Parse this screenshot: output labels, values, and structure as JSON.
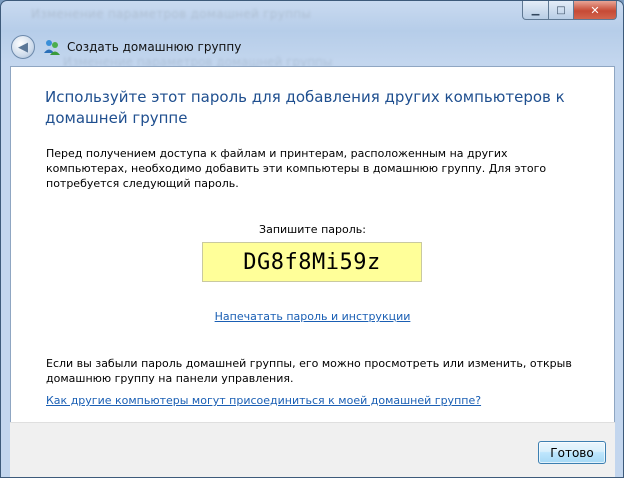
{
  "window": {
    "background_title": "Изменение параметров домашней группы",
    "background_crumb": "Изменение параметров домашней группы"
  },
  "nav": {
    "breadcrumb": "Создать домашнюю группу"
  },
  "main": {
    "heading": "Используйте этот пароль для добавления других компьютеров к домашней группе",
    "intro": "Перед получением доступа к файлам и принтерам, расположенным на других компьютерах, необходимо добавить эти компьютеры в домашнюю группу. Для этого потребуется следующий пароль.",
    "password_label": "Запишите пароль:",
    "password": "DG8f8Mi59z",
    "print_link": "Напечатать пароль и инструкции",
    "forgot_text": "Если вы забыли пароль домашней группы, его можно просмотреть или изменить, открыв домашнюю группу на панели управления.",
    "join_link": "Как другие компьютеры могут присоединиться к моей домашней группе?"
  },
  "footer": {
    "finish_label": "Готово"
  },
  "colors": {
    "heading": "#1f4f8f",
    "link": "#1a5fb4",
    "password_bg": "#ffff99"
  }
}
